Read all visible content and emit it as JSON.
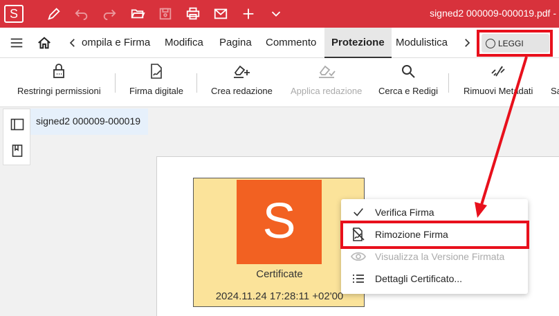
{
  "titlebar": {
    "logo": "S",
    "doc_title": "signed2 000009-000019.pdf  -"
  },
  "tabs": [
    {
      "label": "ompila e Firma"
    },
    {
      "label": "Modifica"
    },
    {
      "label": "Pagina"
    },
    {
      "label": "Commento"
    },
    {
      "label": "Protezione"
    },
    {
      "label": "Modulistica"
    }
  ],
  "read_toggle": {
    "label": "LEGGI"
  },
  "ribbon": [
    {
      "label": "Restringi permissioni"
    },
    {
      "label": "Firma digitale"
    },
    {
      "label": "Crea redazione"
    },
    {
      "label": "Applica redazione"
    },
    {
      "label": "Cerca e Redigi"
    },
    {
      "label": "Rimuovi Metadati"
    },
    {
      "label": "Sa"
    }
  ],
  "doc_tab": {
    "label": "signed2 000009-000019"
  },
  "signature": {
    "logo": "S",
    "caption": "Certificate",
    "date": "2024.11.24 17:28:11 +02'00"
  },
  "context_menu": [
    {
      "label": "Verifica Firma"
    },
    {
      "label": "Rimozione Firma"
    },
    {
      "label": "Visualizza la Versione Firmata"
    },
    {
      "label": "Dettagli Certificato..."
    }
  ],
  "colors": {
    "brand": "#d8323c",
    "annotation": "#e8101c",
    "signature_bg": "#fbe39a",
    "logo_bg": "#f26122"
  }
}
